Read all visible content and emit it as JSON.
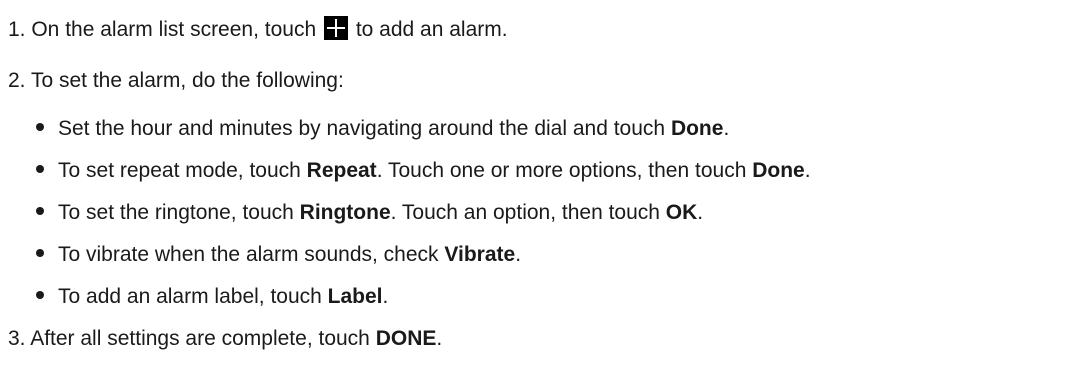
{
  "steps": {
    "step1": {
      "before": "1. On the alarm list screen, touch ",
      "icon": "plus-icon",
      "after": " to add an alarm."
    },
    "step2": {
      "text": "2. To set the alarm, do the following:"
    },
    "step3": {
      "before": "3. After all settings are complete, touch ",
      "bold": "DONE",
      "after": "."
    }
  },
  "bullets": [
    {
      "p1": "Set the hour and minutes by navigating around the dial and touch ",
      "b1": "Done",
      "p2": "."
    },
    {
      "p1": "To set repeat mode, touch ",
      "b1": "Repeat",
      "p2": ". Touch one or more options, then touch ",
      "b2": "Done",
      "p3": "."
    },
    {
      "p1": "To set the ringtone, touch ",
      "b1": "Ringtone",
      "p2": ". Touch an option, then touch ",
      "b2": "OK",
      "p3": "."
    },
    {
      "p1": "To vibrate when the alarm sounds, check ",
      "b1": "Vibrate",
      "p2": "."
    },
    {
      "p1": "To add an alarm label, touch ",
      "b1": "Label",
      "p2": "."
    }
  ]
}
